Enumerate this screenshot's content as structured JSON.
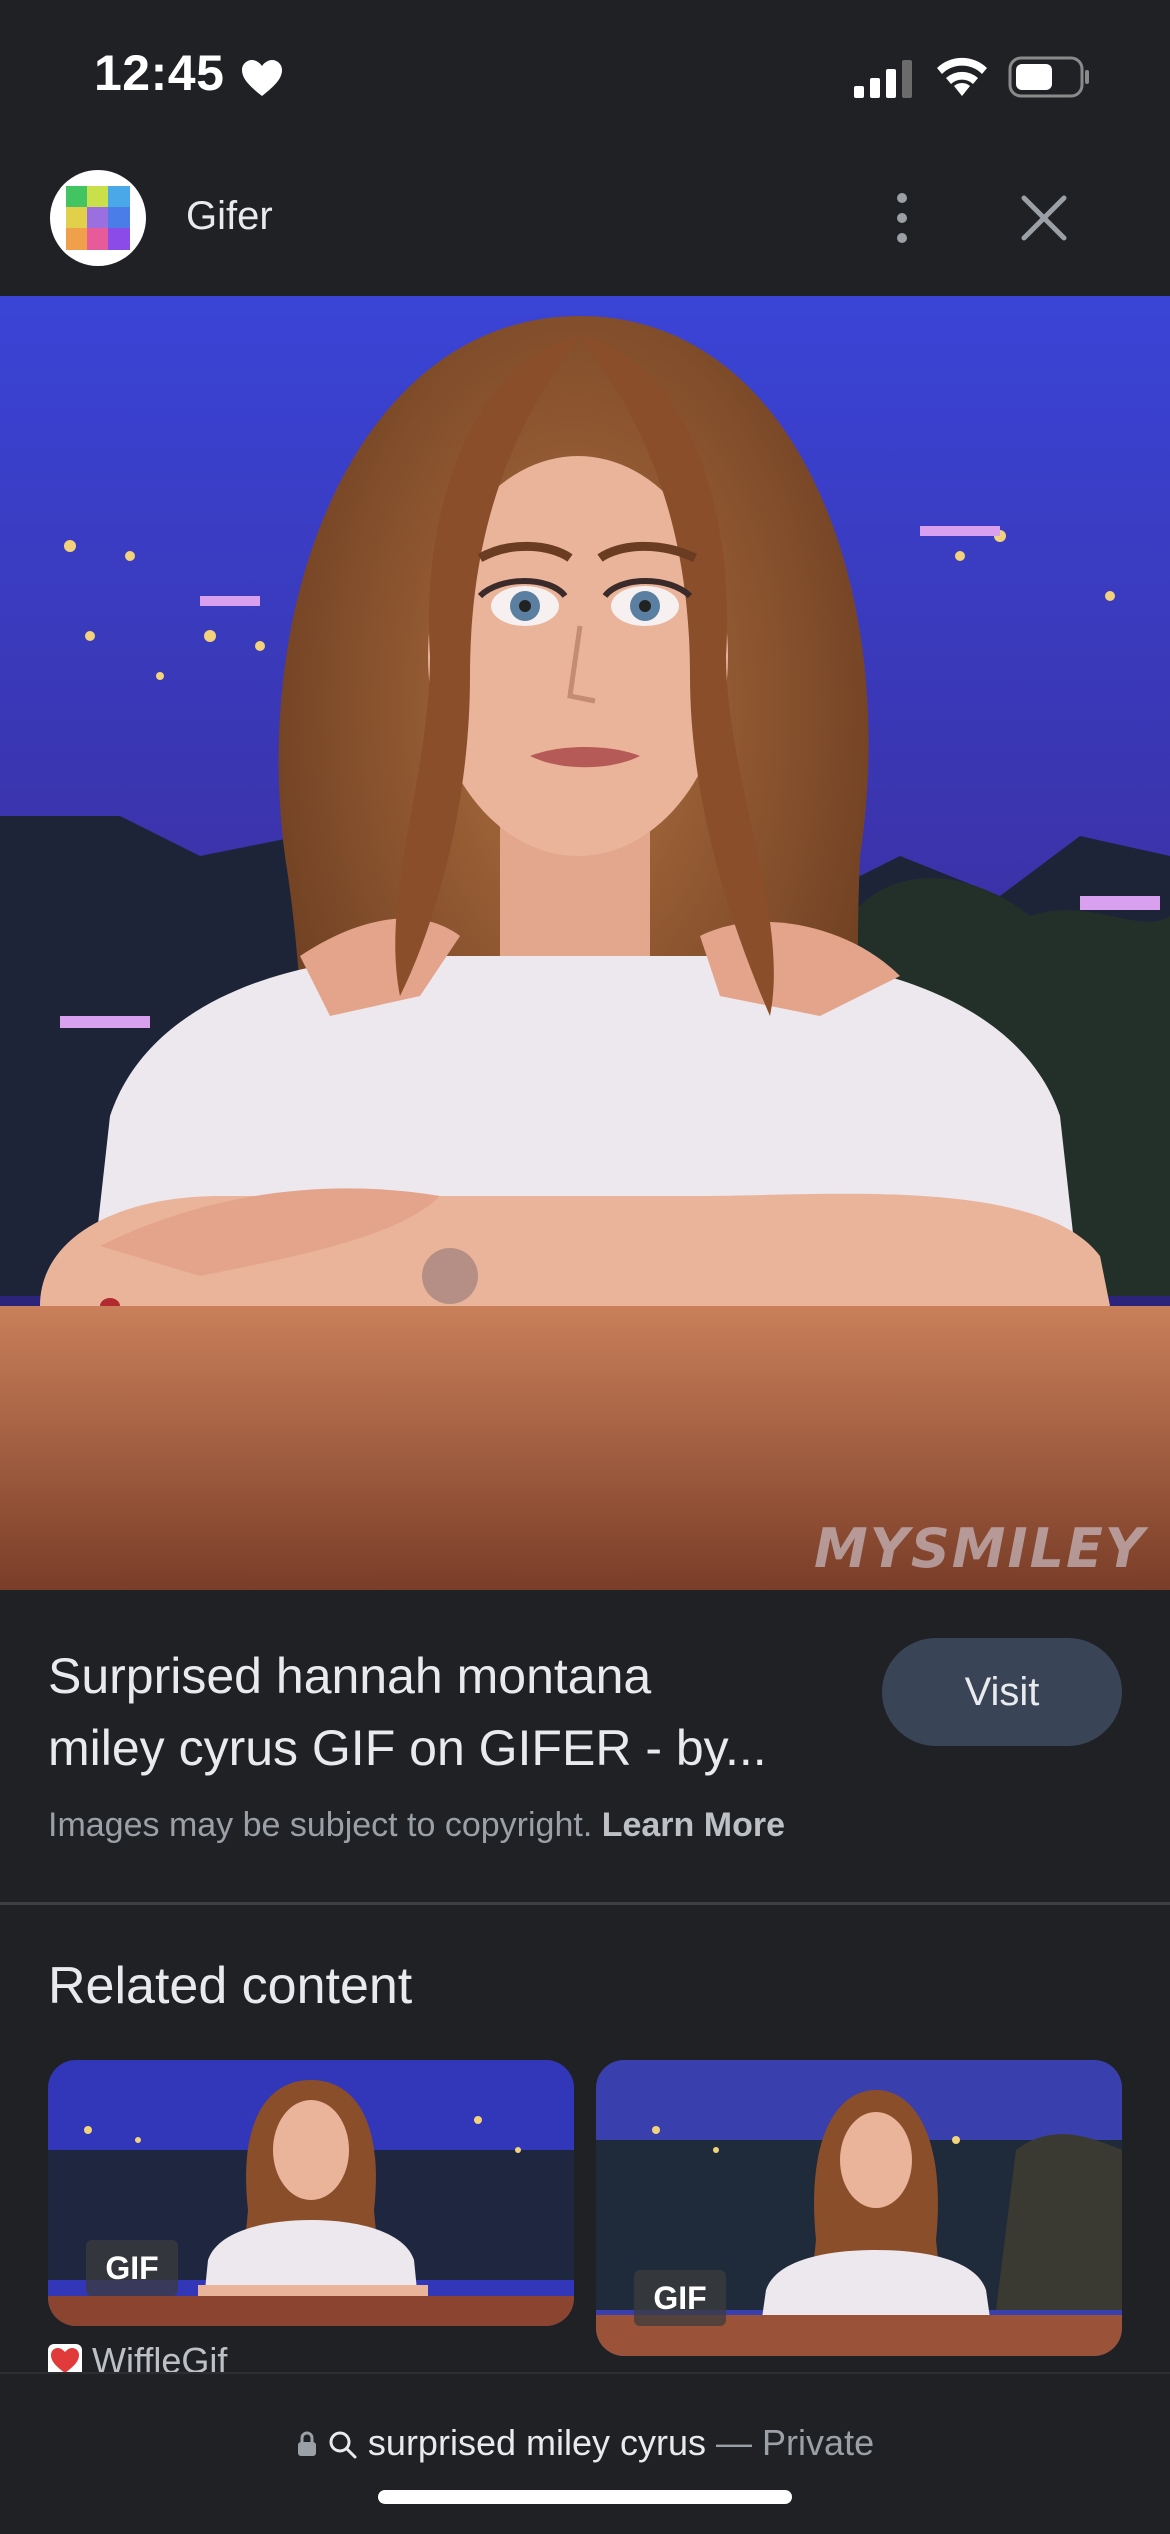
{
  "status_bar": {
    "time": "12:45"
  },
  "header": {
    "site_name": "Gifer"
  },
  "main_image": {
    "watermark": "MYSMILEY"
  },
  "info": {
    "title_line1": "Surprised hannah montana",
    "title_line2": "miley cyrus GIF on GIFER - by...",
    "visit_label": "Visit",
    "copyright": "Images may be subject to copyright.",
    "learn_more": "Learn More"
  },
  "related": {
    "heading": "Related content",
    "items": [
      {
        "badge": "GIF",
        "source": "WiffleGif"
      },
      {
        "badge": "GIF",
        "source": ""
      }
    ]
  },
  "bottom_bar": {
    "query": "surprised miley cyrus",
    "separator": "—",
    "mode": "Private"
  },
  "colors": {
    "background": "#202124",
    "button": "#394457",
    "sky": "#3a3fcf"
  }
}
